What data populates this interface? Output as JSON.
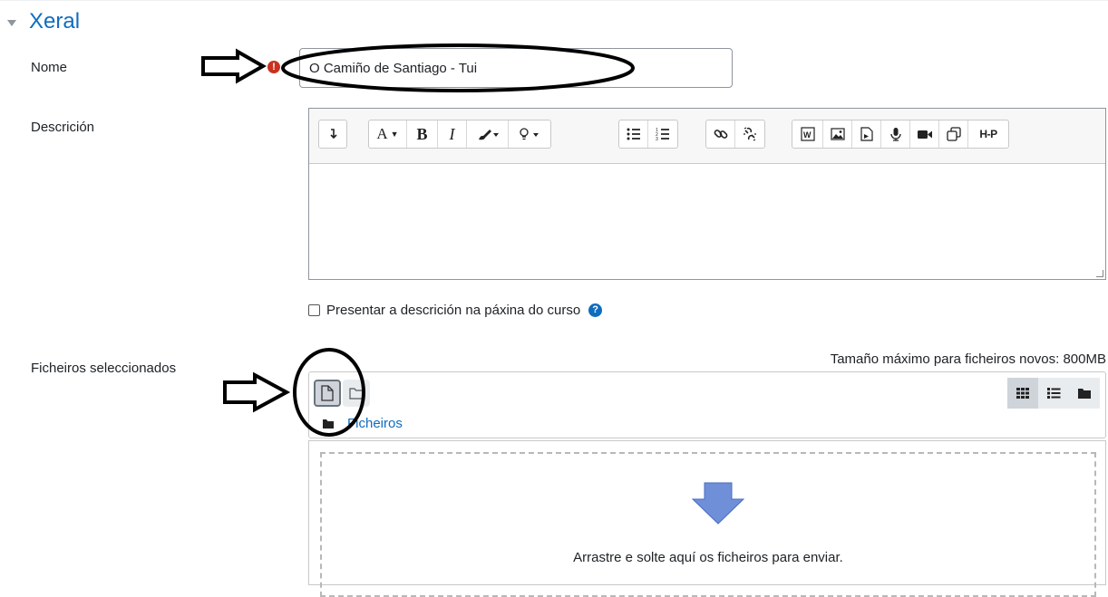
{
  "section": {
    "title": "Xeral"
  },
  "fields": {
    "name": {
      "label": "Nome",
      "value": "O Camiño de Santiago - Tui",
      "required_icon": "exclamation-icon"
    },
    "description": {
      "label": "Descrición",
      "toolbar_groups": [
        [
          "↲"
        ],
        [
          "A▾",
          "B",
          "I",
          "✎▾",
          "💡▾"
        ],
        [
          "bulleted-list",
          "numbered-list"
        ],
        [
          "link",
          "unlink"
        ],
        [
          "word-paste",
          "image",
          "media-file",
          "record-audio",
          "record-video",
          "manage-files",
          "H5P"
        ]
      ],
      "h5p_label": "H-P"
    },
    "show_description": {
      "label": "Presentar a descrición na páxina do curso",
      "checked": false,
      "help": "?"
    },
    "files": {
      "label": "Ficheiros seleccionados",
      "max_size": "Tamaño máximo para ficheiros novos: 800MB",
      "folder_label": "Ficheiros",
      "drop_text": "Arrastre e solte aquí os ficheiros para enviar."
    }
  },
  "annotations": {
    "required_mark": "!"
  },
  "colors": {
    "accent": "#0f6cbf",
    "required": "#ca3120",
    "arrow": "#6f8fd8"
  }
}
